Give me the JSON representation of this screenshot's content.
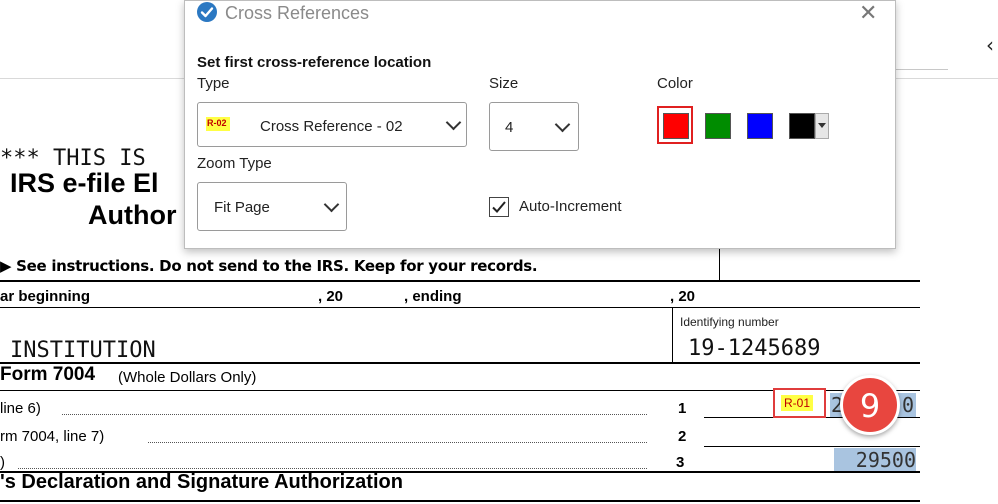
{
  "dialog": {
    "title": "Cross References",
    "instruction": "Set first cross-reference location",
    "type_label": "Type",
    "type_value": "Cross Reference - 02",
    "type_icon_text": "R-02",
    "size_label": "Size",
    "size_value": "4",
    "color_label": "Color",
    "colors": [
      "#ff0000",
      "#008c00",
      "#0000ff",
      "#000000"
    ],
    "selected_color": "#ff0000",
    "zoom_label": "Zoom Type",
    "zoom_value": "Fit Page",
    "auto_increment_label": "Auto-Increment",
    "auto_increment_checked": true
  },
  "document": {
    "banner": "*** THIS IS",
    "heading_1": "IRS e-file El",
    "heading_2": "Author",
    "instructions": "▶ See instructions. Do not send to the IRS. Keep for your records.",
    "year_beginning": "ar beginning",
    "comma_20_a": ", 20",
    "ending": ", ending",
    "comma_20_b": ", 20",
    "id_label": "Identifying number",
    "id_value": "19-1245689",
    "name": "INSTITUTION",
    "form_title": "Form 7004",
    "form_subtitle": "(Whole Dollars Only)",
    "lines": [
      {
        "text": "line 6)",
        "num": "1"
      },
      {
        "text": "rm 7004, line 7)",
        "num": "2"
      },
      {
        "text": ")",
        "num": "3"
      }
    ],
    "marker_r01": "R-01",
    "badge_number": "9",
    "line1_value_partial": "2",
    "line1_value_tail": "0",
    "line3_value": "29500",
    "declaration": "'s Declaration and Signature Authorization"
  }
}
